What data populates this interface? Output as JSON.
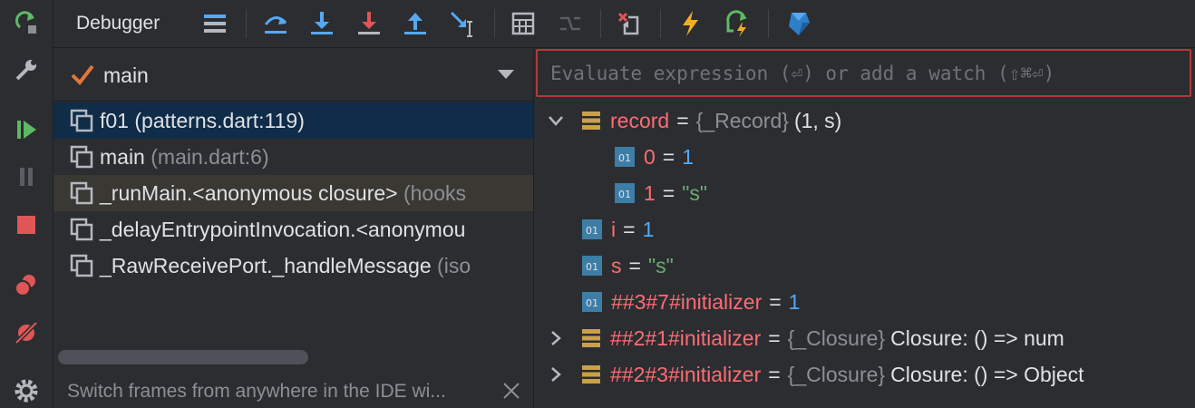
{
  "toolbar": {
    "title": "Debugger"
  },
  "thread": {
    "name": "main"
  },
  "frames": [
    {
      "name": "f01 (patterns.dart:119)",
      "location": ""
    },
    {
      "name": "main",
      "location": "(main.dart:6)"
    },
    {
      "name": "_runMain.<anonymous closure>",
      "location": "(hooks"
    },
    {
      "name": "_delayEntrypointInvocation.<anonymou",
      "location": ""
    },
    {
      "name": "_RawReceivePort._handleMessage",
      "location": "(iso"
    }
  ],
  "status": {
    "text": "Switch frames from anywhere in the IDE wi..."
  },
  "eval": {
    "placeholder": "Evaluate expression (⏎) or add a watch (⇧⌘⏎)"
  },
  "variables": [
    {
      "name": "record",
      "eq": "=",
      "type": "{_Record}",
      "value": "(1, s)"
    },
    {
      "name": "0",
      "eq": "=",
      "value": "1"
    },
    {
      "name": "1",
      "eq": "=",
      "value": "\"s\""
    },
    {
      "name": "i",
      "eq": "=",
      "value": "1"
    },
    {
      "name": "s",
      "eq": "=",
      "value": "\"s\""
    },
    {
      "name": "##3#7#initializer",
      "eq": "=",
      "value": "1"
    },
    {
      "name": "##2#1#initializer",
      "eq": "=",
      "type": "{_Closure}",
      "value": "Closure: () => num"
    },
    {
      "name": "##2#3#initializer",
      "eq": "=",
      "type": "{_Closure}",
      "value": "Closure: () => Object"
    }
  ],
  "icon_names": {
    "rerun": "rerun-icon",
    "settings": "wrench-icon",
    "resume": "resume-icon",
    "pause": "pause-icon",
    "stop": "stop-icon",
    "view_breakpoints": "breakpoints-icon",
    "mute_breakpoints": "mute-breakpoints-icon",
    "gear": "gear-icon"
  },
  "colors": {
    "accent_blue": "#56a8f5",
    "accent_red": "#ff6b74",
    "accent_green": "#5fb865",
    "selection": "#0f2c48"
  }
}
